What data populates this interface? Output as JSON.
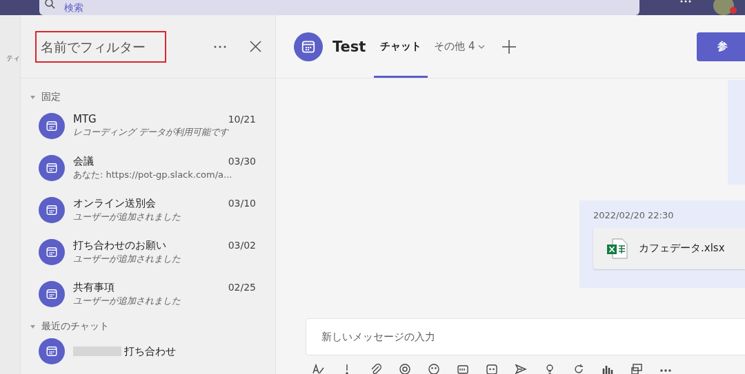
{
  "top_bar": {
    "search": {
      "placeholder": "検索"
    }
  },
  "rail": {
    "label": "ティ"
  },
  "sidebar": {
    "filter": {
      "placeholder": "名前でフィルター"
    },
    "sections": [
      {
        "title": "固定",
        "expanded": true,
        "chats": [
          {
            "name": "MTG",
            "date": "10/21",
            "preview": "レコーディング データが利用可能です",
            "italic": true
          },
          {
            "name": "会議",
            "date": "03/30",
            "preview": "あなた: https://pot-gp.slack.com/a...",
            "italic": false
          },
          {
            "name": "オンライン送別会",
            "date": "03/10",
            "preview": "ユーザーが追加されました",
            "italic": true
          },
          {
            "name": "打ち合わせのお願い",
            "date": "03/02",
            "preview": "ユーザーが追加されました",
            "italic": true
          },
          {
            "name": "共有事項",
            "date": "02/25",
            "preview": "ユーザーが追加されました",
            "italic": true
          }
        ]
      },
      {
        "title": "最近のチャット",
        "expanded": true,
        "chats": [
          {
            "name": "打ち合わせ",
            "redacted": true
          }
        ]
      }
    ]
  },
  "chat": {
    "title": "Test",
    "tabs": [
      {
        "label": "チャット",
        "selected": true,
        "kind": "tab"
      },
      {
        "label": "その他 4",
        "selected": false,
        "kind": "menu"
      }
    ],
    "join_button": "参",
    "messages": [
      {
        "time": "2022/02/20 22:30",
        "file": "カフェデータ.xlsx"
      }
    ],
    "compose": {
      "placeholder": "新しいメッセージの入力"
    }
  }
}
